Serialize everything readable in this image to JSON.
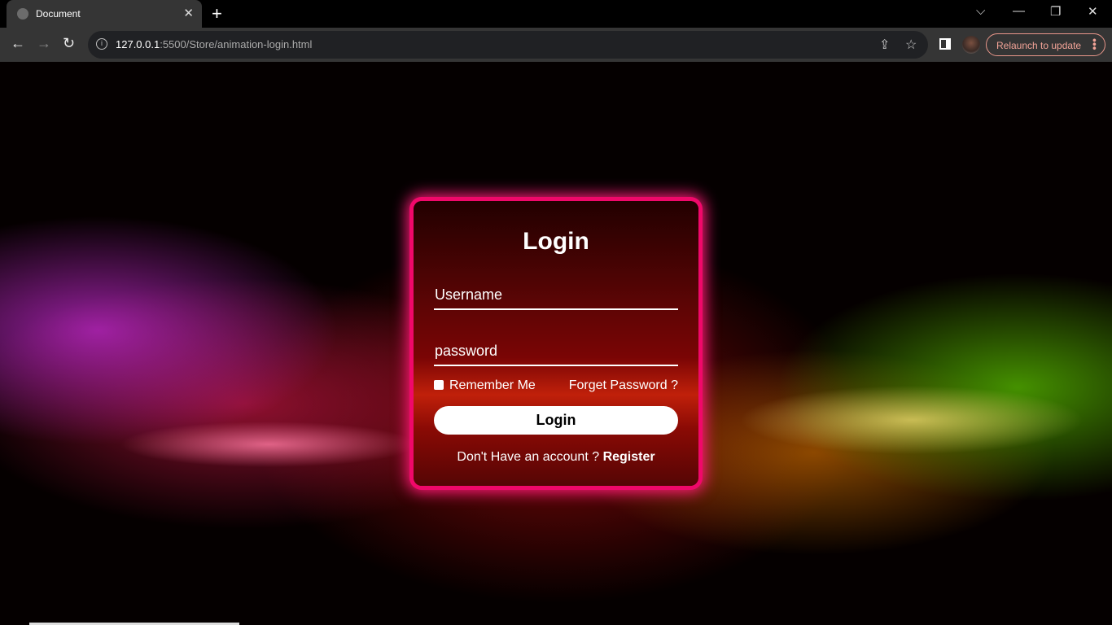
{
  "browser": {
    "tab_title": "Document",
    "url_host": "127.0.0.1",
    "url_rest": ":5500/Store/animation-login.html",
    "relaunch_label": "Relaunch to update"
  },
  "login": {
    "title": "Login",
    "username_placeholder": "Username",
    "password_placeholder": "password",
    "remember_label": "Remember Me",
    "remember_checked": false,
    "forgot_label": "Forget Password ?",
    "button_label": "Login",
    "register_prompt": "Don't Have an account ?",
    "register_link": "Register"
  },
  "colors": {
    "glow": "#f0086a",
    "card": "#6a0505"
  }
}
